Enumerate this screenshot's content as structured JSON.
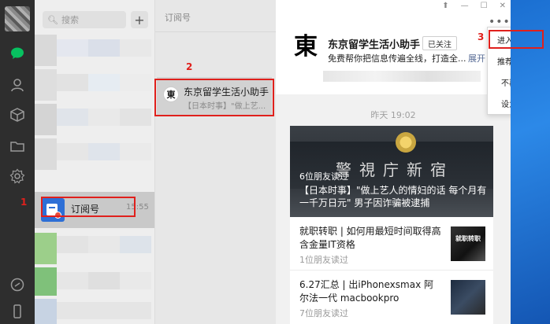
{
  "search": {
    "placeholder": "搜索"
  },
  "new_chat_icon": "plus-icon",
  "nav_icons": [
    "chat-icon",
    "contacts-icon",
    "favorites-icon",
    "folder-icon",
    "settings-icon",
    "mini-program-icon",
    "phone-icon"
  ],
  "subscription_row": {
    "label": "订阅号",
    "time": "15:55"
  },
  "subscription_column": {
    "title": "订阅号",
    "account": {
      "avatar_char": "東",
      "name": "东京留学生活小助手",
      "preview": "【日本时事】\"做上艺..."
    }
  },
  "window_controls": [
    "⬆",
    "—",
    "☐",
    "✕"
  ],
  "account_header": {
    "avatar_char": "東",
    "name": "东京留学生活小助手",
    "follow_status": "已关注",
    "description": "免费帮你把信息传遍全线，打造全...",
    "expand": "展开"
  },
  "date_divider": "昨天 19:02",
  "main_article": {
    "reads": "6位朋友读过",
    "title": "【日本时事】\"做上艺人的情妇的话 每个月有一千万日元\" 男子因诈骗被逮捕",
    "hero_sign": "警視庁新宿"
  },
  "articles": [
    {
      "title": "就职转职 | 如何用最短时间取得高含金量IT资格",
      "reads": "1位朋友读过",
      "thumb_text": "就职转职"
    },
    {
      "title": "6.27汇总 | 出iPhonexsmax 阿尔法一代 macbookpro",
      "reads": "7位朋友读过",
      "thumb_text": ""
    }
  ],
  "context_menu": [
    "进入公众号",
    "推荐给朋友",
    "不再关注",
    "设为星标"
  ],
  "annotations": [
    "1",
    "2",
    "3"
  ],
  "colors": {
    "annotation": "#e0201c",
    "link": "#576b95",
    "nav_bg": "#2e2e2e",
    "accent_green": "#07c160"
  }
}
